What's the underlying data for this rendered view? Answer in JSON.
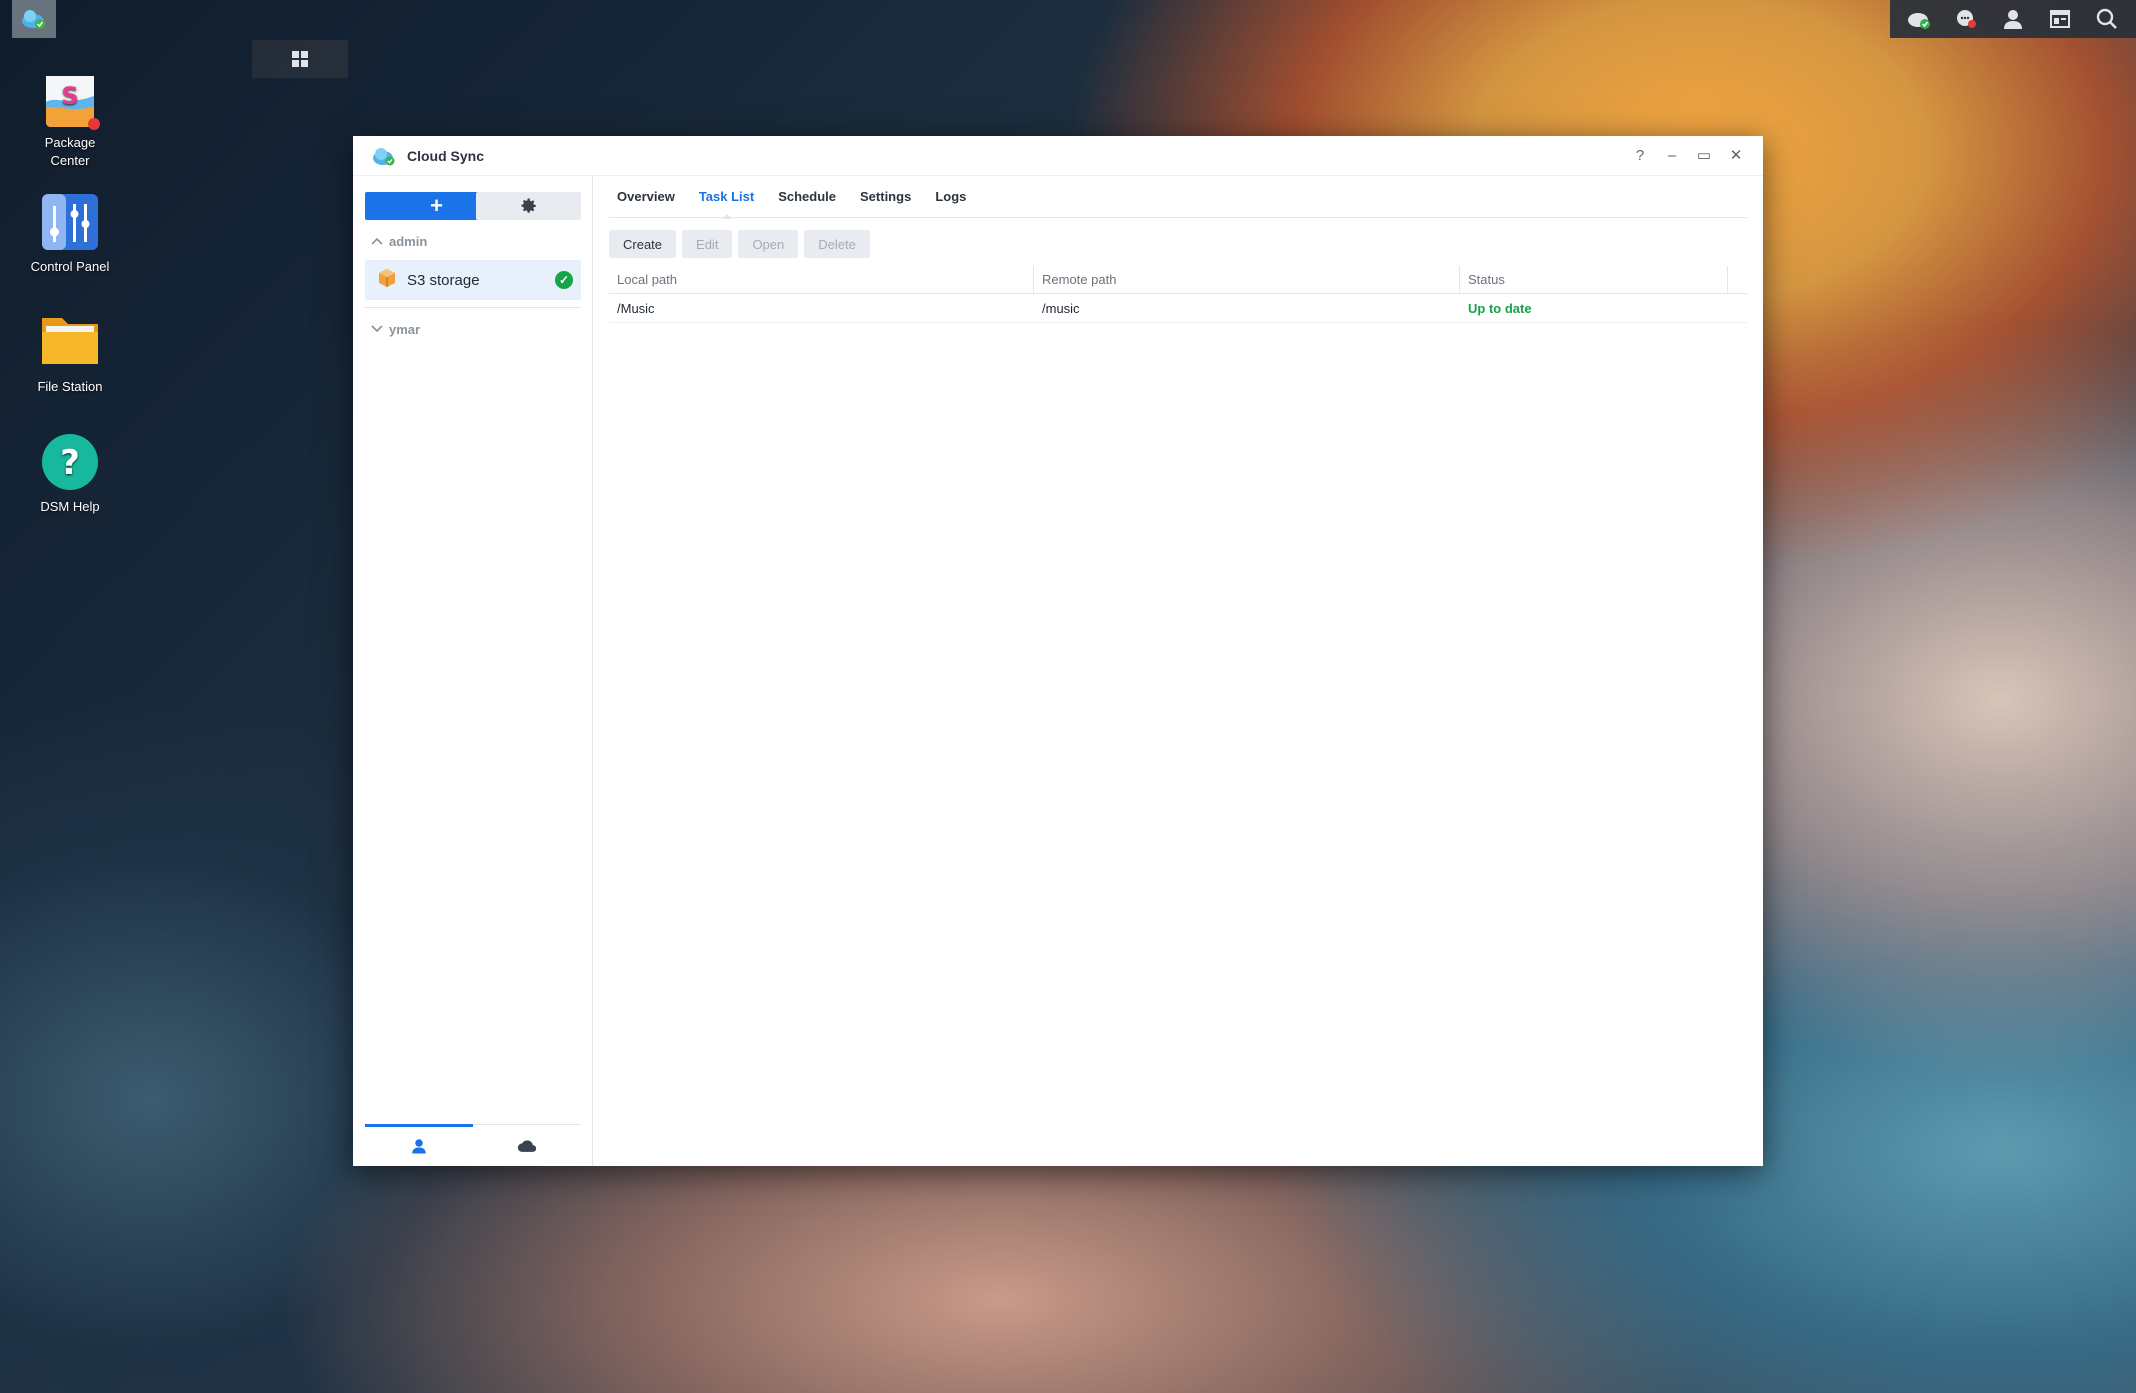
{
  "taskbar": {
    "main_menu_icon": "grid-icon",
    "active_app_icon": "cloud-sync-icon"
  },
  "tray": {
    "icons": [
      "cloud-sync-status-icon",
      "notifications-icon",
      "user-icon",
      "widgets-icon",
      "search-icon"
    ]
  },
  "desktop": {
    "package_center": "Package\nCenter",
    "control_panel": "Control Panel",
    "file_station": "File Station",
    "dsm_help": "DSM Help"
  },
  "window": {
    "title": "Cloud Sync",
    "controls": {
      "help": "?",
      "minimize": "–",
      "maximize": "▭",
      "close": "✕"
    }
  },
  "sidebar": {
    "add_label": "+",
    "groups": [
      {
        "label": "admin",
        "expanded": true,
        "items": [
          {
            "name": "S3 storage",
            "status": "ok"
          }
        ]
      },
      {
        "label": "ymar",
        "expanded": false,
        "items": []
      }
    ]
  },
  "main": {
    "tabs": [
      {
        "label": "Overview",
        "active": false
      },
      {
        "label": "Task List",
        "active": true
      },
      {
        "label": "Schedule",
        "active": false
      },
      {
        "label": "Settings",
        "active": false
      },
      {
        "label": "Logs",
        "active": false
      }
    ],
    "toolbar": {
      "create": "Create",
      "edit": "Edit",
      "open": "Open",
      "delete": "Delete"
    },
    "table": {
      "headers": [
        "Local path",
        "Remote path",
        "Status"
      ],
      "rows": [
        {
          "local": "/Music",
          "remote": "/music",
          "status": "Up to date"
        }
      ]
    }
  },
  "colors": {
    "accent": "#1a73e8",
    "success": "#17a34a"
  }
}
